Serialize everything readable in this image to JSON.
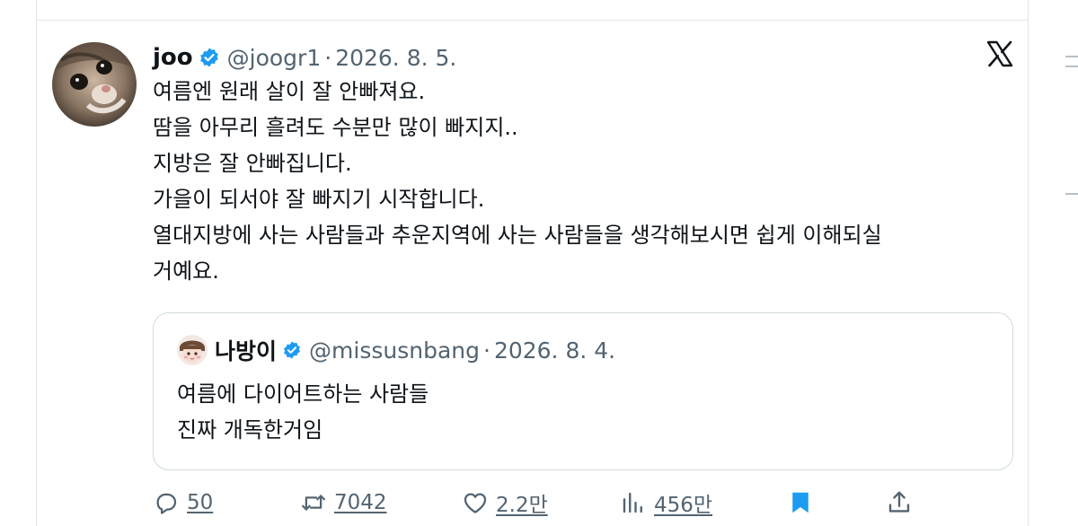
{
  "tweet": {
    "author": {
      "display_name": "joo",
      "handle": "@joogr1",
      "verified": true
    },
    "separator": "·",
    "date": "2026. 8. 5.",
    "lines": [
      "여름엔 원래 살이 잘 안빠져요.",
      "땀을 아무리 흘려도 수분만 많이 빠지지..",
      "지방은 잘 안빠집니다.",
      "가을이 되서야 잘 빠지기 시작합니다.",
      "열대지방에 사는 사람들과 추운지역에 사는 사람들을 생각해보시면 쉽게 이해되실",
      "거예요."
    ],
    "platform_icon": "x-logo-icon"
  },
  "quote": {
    "author": {
      "display_name": "나방이",
      "handle": "@missusnbang",
      "verified": true
    },
    "separator": "·",
    "date": "2026. 8. 4.",
    "lines": [
      "여름에 다이어트하는 사람들",
      "진짜 개독한거임"
    ]
  },
  "actions": {
    "replies": {
      "icon": "reply-icon",
      "count": "50"
    },
    "retweets": {
      "icon": "retweet-icon",
      "count": "7042"
    },
    "likes": {
      "icon": "heart-icon",
      "count": "2.2만"
    },
    "views": {
      "icon": "views-icon",
      "count": "456만"
    },
    "bookmark": {
      "icon": "bookmark-icon",
      "active": true
    },
    "share": {
      "icon": "share-icon"
    }
  },
  "colors": {
    "text_primary": "#0f1419",
    "text_secondary": "#536471",
    "verified_blue": "#1d9bf0",
    "border": "#cfd9de"
  }
}
